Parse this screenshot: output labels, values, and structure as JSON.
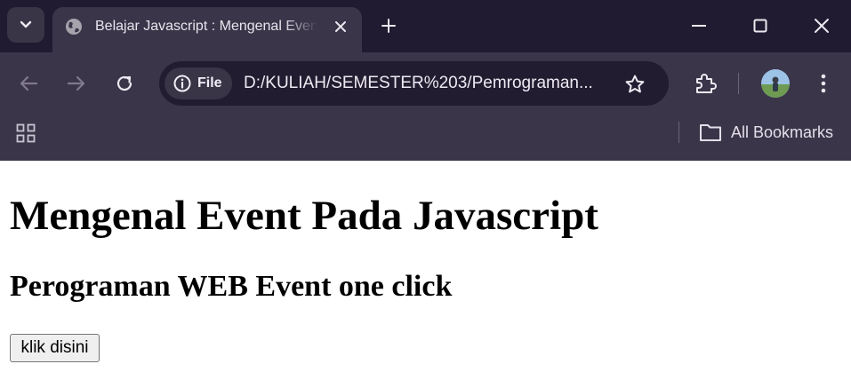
{
  "browser": {
    "tab": {
      "title": "Belajar Javascript : Mengenal Event Pada Javascript"
    },
    "address_bar": {
      "site_chip_label": "File",
      "url": "D:/KULIAH/SEMESTER%203/Pemrograman..."
    },
    "bookmarks_bar": {
      "all_bookmarks_label": "All Bookmarks"
    },
    "icons": [
      "chevron-down-icon",
      "globe-icon",
      "close-icon",
      "plus-icon",
      "minimize-icon",
      "maximize-icon",
      "close-window-icon",
      "back-arrow-icon",
      "forward-arrow-icon",
      "reload-icon",
      "info-icon",
      "star-icon",
      "extensions-icon",
      "avatar",
      "more-vert-icon",
      "apps-grid-icon",
      "folder-icon"
    ]
  },
  "page": {
    "heading": "Mengenal Event Pada Javascript",
    "subheading": "Perograman WEB Event one click",
    "button_label": "klik disini"
  }
}
